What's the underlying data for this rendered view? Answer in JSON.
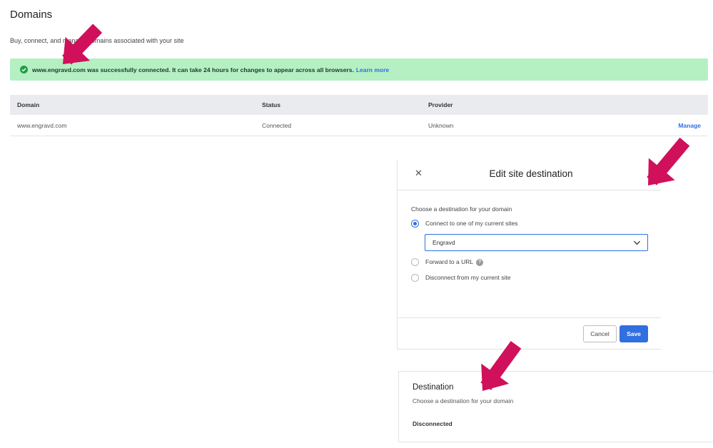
{
  "page": {
    "title": "Domains",
    "subtitle": "Buy, connect, and manage domains associated with your site"
  },
  "banner": {
    "message": "www.engravd.com was successfully connected. It can take 24 hours for changes to appear across all browsers.",
    "link_label": "Learn more",
    "color": "#b5f0c3"
  },
  "table": {
    "columns": [
      "Domain",
      "Status",
      "Provider"
    ],
    "rows": [
      {
        "domain": "www.engravd.com",
        "status": "Connected",
        "provider": "Unknown",
        "action": "Manage"
      }
    ]
  },
  "modal": {
    "title": "Edit site destination",
    "close_icon": "close-icon",
    "prompt": "Choose a destination for your domain",
    "options": [
      {
        "label": "Connect to one of my current sites",
        "selected": true
      },
      {
        "label": "Forward to a URL",
        "selected": false
      },
      {
        "label": "Disconnect from my current site",
        "selected": false
      }
    ],
    "site_select_value": "Engravd",
    "cancel_label": "Cancel",
    "save_label": "Save"
  },
  "destination": {
    "title": "Destination",
    "subtitle": "Choose a destination for your domain",
    "value": "Disconnected"
  },
  "colors": {
    "accent": "#2f6fe0",
    "success_banner": "#b5f0c3",
    "arrow": "#d0105a"
  }
}
